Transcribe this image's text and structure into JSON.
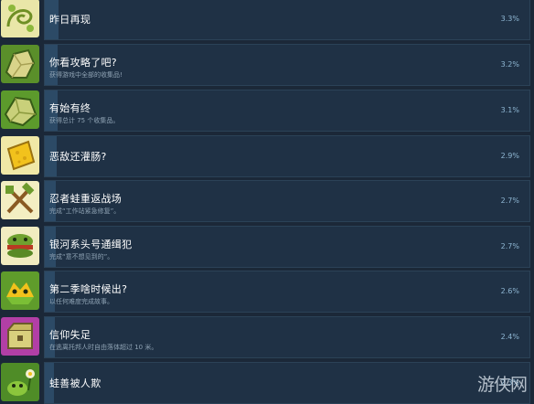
{
  "achievements": [
    {
      "title": "昨日再现",
      "desc": "",
      "percent": "3.3%",
      "fill": 0.033
    },
    {
      "title": "你看攻略了吧?",
      "desc": "获得游戏中全部的收集品!",
      "percent": "3.2%",
      "fill": 0.032
    },
    {
      "title": "有始有终",
      "desc": "获得总计 75 个收集品。",
      "percent": "3.1%",
      "fill": 0.031
    },
    {
      "title": "恶敌还灌肠?",
      "desc": "",
      "percent": "2.9%",
      "fill": 0.029
    },
    {
      "title": "忍者蛙重返战场",
      "desc": "完成“工作站紧急修复”。",
      "percent": "2.7%",
      "fill": 0.027
    },
    {
      "title": "银河系头号通缉犯",
      "desc": "完成“意不想见到的”。",
      "percent": "2.7%",
      "fill": 0.027
    },
    {
      "title": "第二季啥时候出?",
      "desc": "以任何难度完成故事。",
      "percent": "2.6%",
      "fill": 0.026
    },
    {
      "title": "信仰失足",
      "desc": "在逃离托邦人时自由落体超过 10 米。",
      "percent": "2.4%",
      "fill": 0.024
    },
    {
      "title": "蛙善被人欺",
      "desc": "",
      "percent": "2.3%",
      "fill": 0.023
    }
  ],
  "icons": [
    "swirl-leaves-icon",
    "gold-shard-icon",
    "green-shard-icon",
    "cheese-chip-icon",
    "crossed-tools-icon",
    "frog-burger-icon",
    "frog-face-icon",
    "treasure-chest-icon",
    "frog-and-flower-icon"
  ],
  "watermark": "游侠网",
  "colors": {
    "background": "#1b2838",
    "bar": "#1f3145",
    "fill": "#2c4a66",
    "percent": "#8fb7d3"
  }
}
